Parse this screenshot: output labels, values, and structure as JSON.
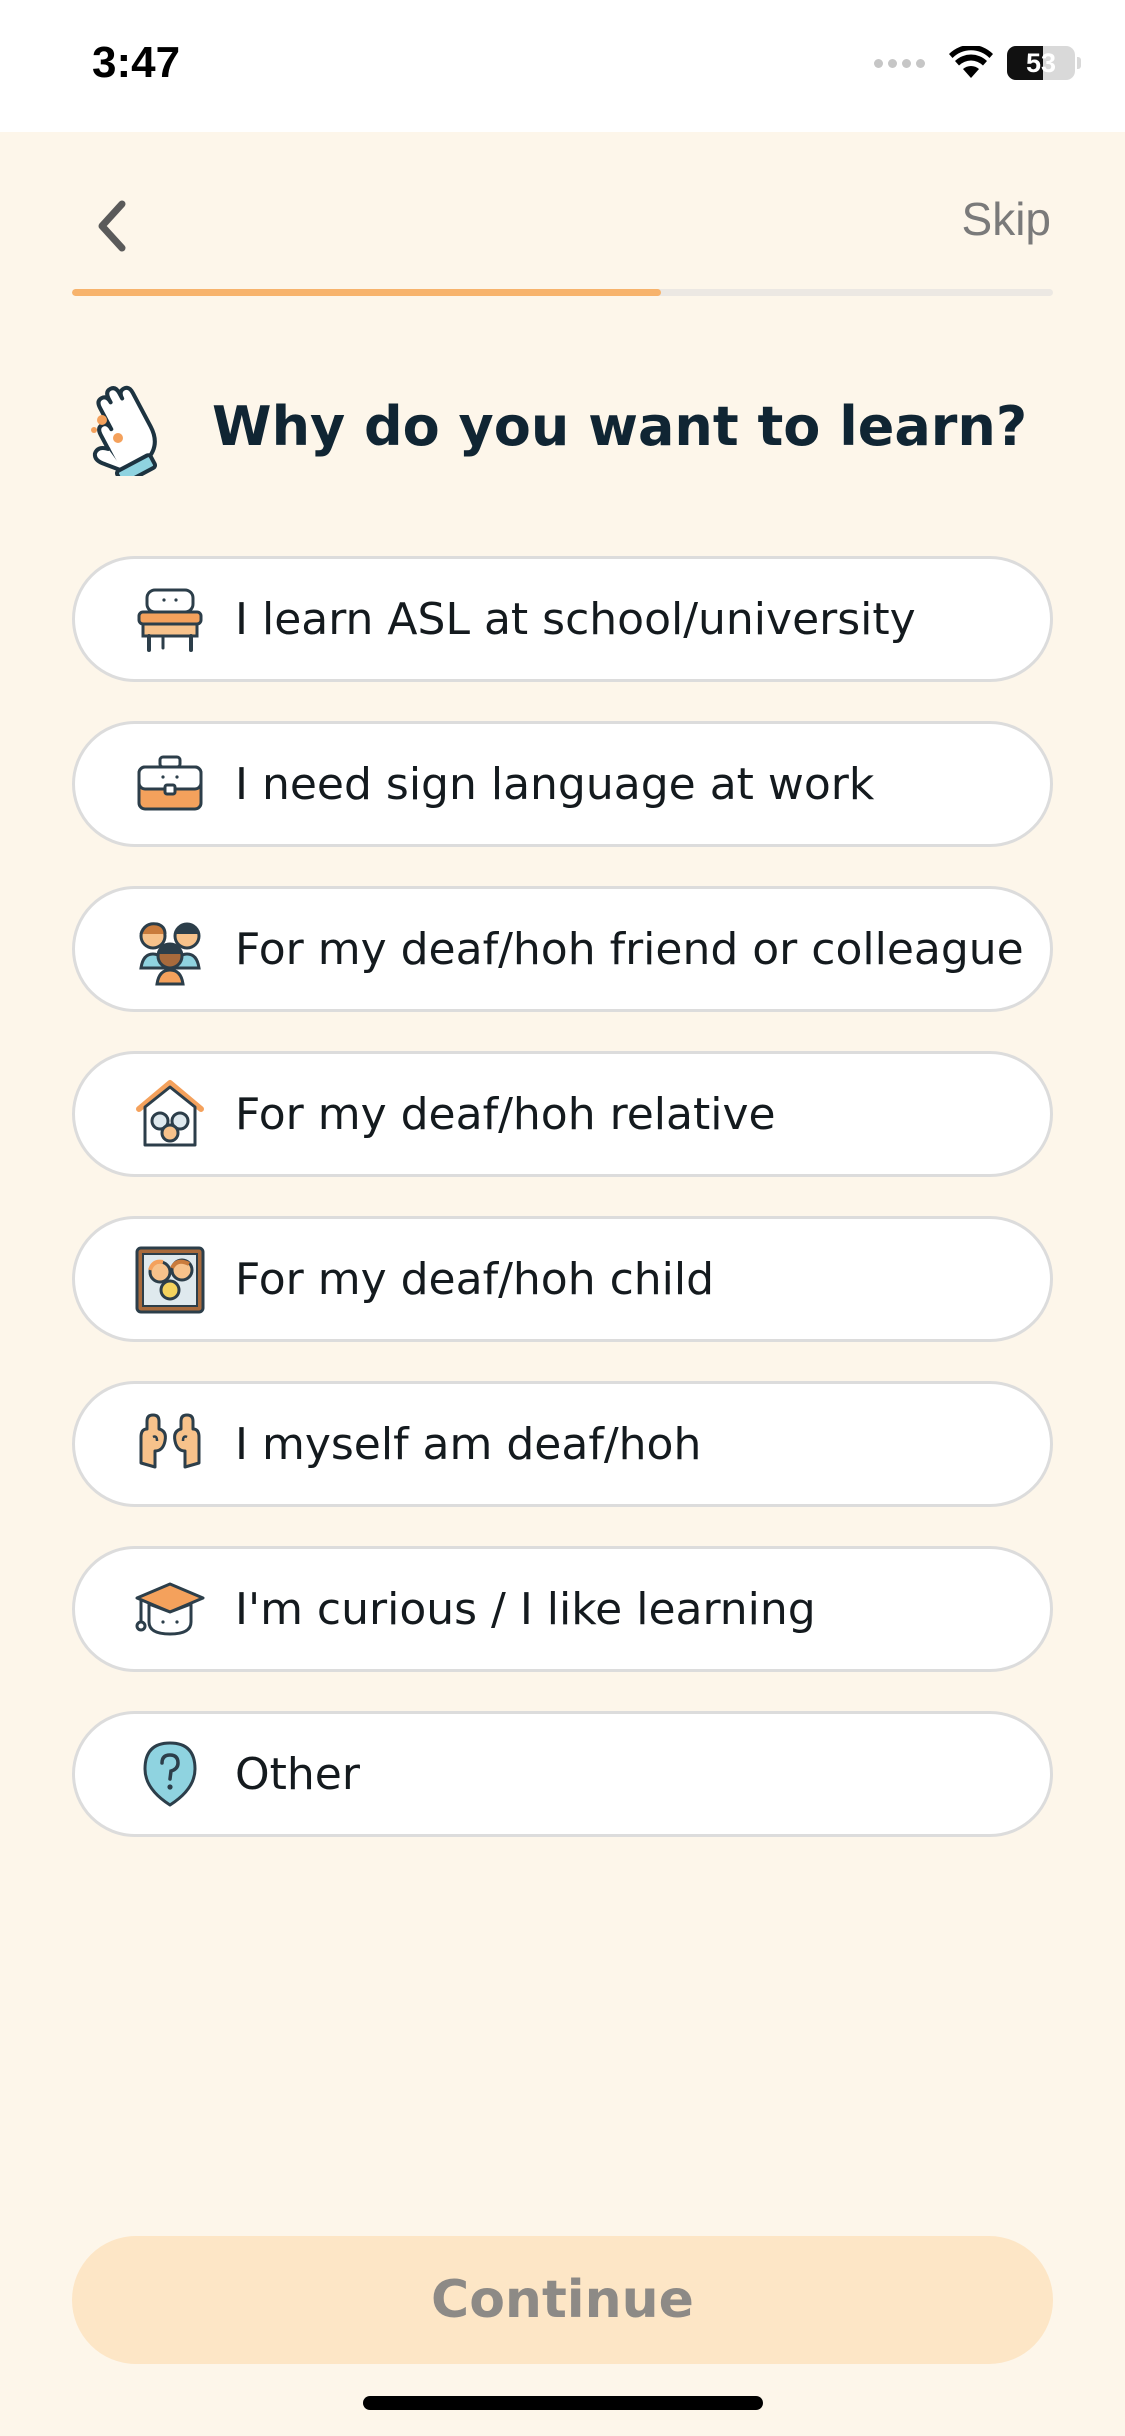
{
  "status_bar": {
    "time": "3:47",
    "battery_level": "53",
    "icons": [
      "cellular-signal-icon",
      "wifi-icon",
      "battery-icon"
    ]
  },
  "nav": {
    "back_icon": "chevron-left-icon",
    "skip_label": "Skip",
    "progress_fraction": 0.6
  },
  "question": {
    "icon": "hand-sign-icon",
    "title": "Why do you want to learn?"
  },
  "options": [
    {
      "icon": "school-desk-icon",
      "label": "I learn ASL at school/university"
    },
    {
      "icon": "briefcase-icon",
      "label": "I need sign language at work"
    },
    {
      "icon": "group-people-icon",
      "label": "For my deaf/hoh friend or colleague"
    },
    {
      "icon": "family-house-icon",
      "label": "For my deaf/hoh relative"
    },
    {
      "icon": "family-portrait-icon",
      "label": "For my deaf/hoh child"
    },
    {
      "icon": "signing-hands-icon",
      "label": "I myself am deaf/hoh"
    },
    {
      "icon": "graduation-cap-icon",
      "label": "I'm curious / I like learning"
    },
    {
      "icon": "question-bubble-icon",
      "label": "Other"
    }
  ],
  "continue_label": "Continue",
  "colors": {
    "background": "#fdf6ea",
    "accent": "#f7b36c",
    "continue_disabled_bg": "#fde6c6",
    "title_text": "#102533",
    "option_border": "#dcdcdc"
  }
}
